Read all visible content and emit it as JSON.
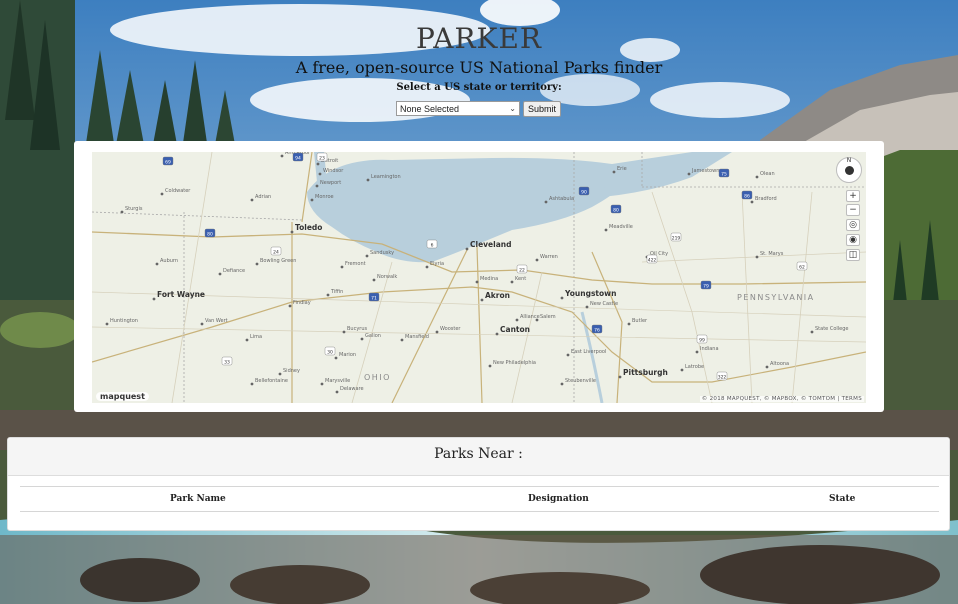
{
  "header": {
    "title": "PARKER",
    "subtitle": "A free, open-source US National Parks finder",
    "select_label": "Select a US state or territory:",
    "select_value": "None Selected",
    "submit_label": "Submit"
  },
  "map": {
    "logo_text": "mapquest",
    "attribution": "© 2018 MAPQUEST, © MAPBOX, © TOMTOM | TERMS",
    "compass_label": "N",
    "zoom_in": "+",
    "zoom_out": "−",
    "cities": [
      "Toledo",
      "Cleveland",
      "Akron",
      "Youngstown",
      "Canton",
      "Pittsburgh",
      "Fort Wayne",
      "Erie",
      "Ann Arbor",
      "Detroit",
      "Sandusky",
      "Lima",
      "Mansfield",
      "Wooster",
      "Findlay",
      "Bowling Green",
      "Defiance",
      "Fremont",
      "Norwalk",
      "Elyria",
      "Medina",
      "Kent",
      "Warren",
      "New Castle",
      "Butler",
      "Meadville",
      "Oil City",
      "Jamestown",
      "Olean",
      "St. Marys",
      "Indiana",
      "State College",
      "Altoona",
      "Latrobe",
      "Steubenville",
      "Bucyrus",
      "Marion",
      "Delaware",
      "Marysville",
      "Bellefontaine",
      "Sidney",
      "Van Wert",
      "Huntington",
      "Auburn",
      "Coldwater",
      "Sturgis",
      "Adrian",
      "Monroe",
      "Windsor",
      "Leamington",
      "Newport",
      "Tiffin",
      "Galion",
      "Ashtabula",
      "Bradford",
      "New Philadelphia",
      "Salem",
      "Alliance",
      "East Liverpool"
    ],
    "region_labels": [
      "PENNSYLVANIA",
      "OHIO"
    ],
    "route_shields": [
      "69",
      "94",
      "23",
      "90",
      "80",
      "75",
      "6",
      "24",
      "30",
      "33",
      "71",
      "76",
      "79",
      "80",
      "86",
      "219",
      "62",
      "322",
      "22",
      "422",
      "99"
    ]
  },
  "parks": {
    "title": "Parks Near :",
    "columns": [
      "Park Name",
      "Designation",
      "State"
    ],
    "rows": []
  },
  "colors": {
    "map_land": "#eef0e6",
    "map_water": "#b8cfdc",
    "highway_shield": "#3a5fb0",
    "card_bg": "#ffffff",
    "card_header_bg": "#f5f5f5"
  }
}
